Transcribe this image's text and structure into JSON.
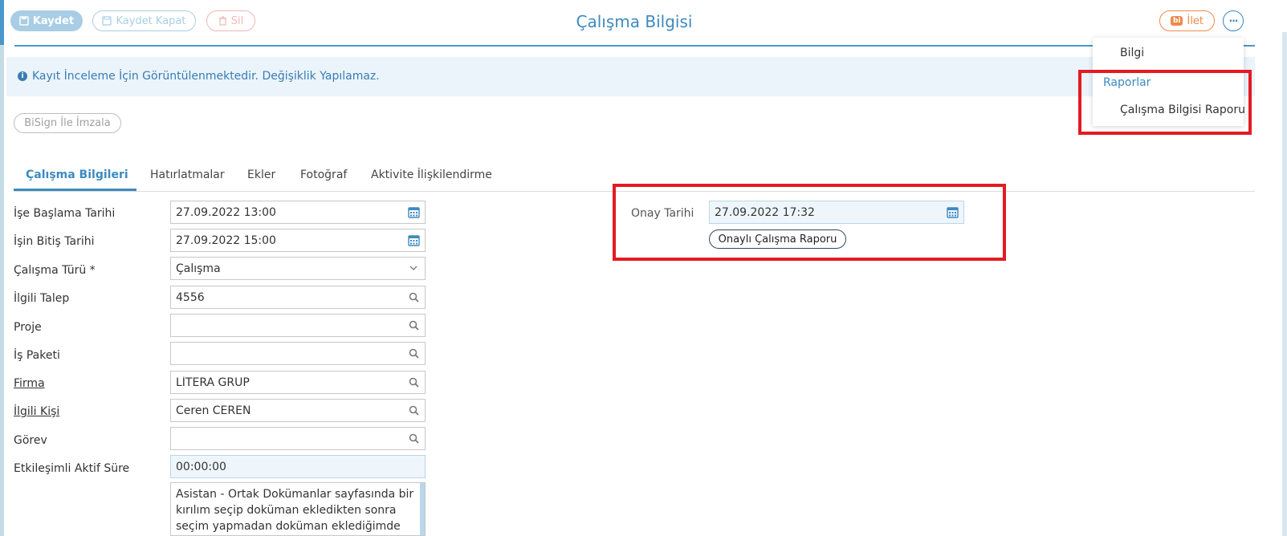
{
  "toolbar": {
    "save_label": "Kaydet",
    "save_close_label": "Kaydet Kapat",
    "delete_label": "Sil",
    "forward_badge": "bi",
    "forward_label": "İlet",
    "more_label": "···"
  },
  "page_title": "Çalışma Bilgisi",
  "info_message": "Kayıt İnceleme İçin Görüntülenmektedir. Değişiklik Yapılamaz.",
  "info_icon": "i",
  "bisign_label": "BiSign İle İmzala",
  "menu": {
    "items": [
      {
        "label": "Bilgi"
      },
      {
        "label": "Raporlar"
      },
      {
        "label": "Çalışma Bilgisi Raporu"
      }
    ]
  },
  "tabs": [
    {
      "label": "Çalışma Bilgileri"
    },
    {
      "label": "Hatırlatmalar"
    },
    {
      "label": "Ekler"
    },
    {
      "label": "Fotoğraf"
    },
    {
      "label": "Aktivite İlişkilendirme"
    }
  ],
  "form": {
    "start_date": {
      "label": "İşe Başlama Tarihi",
      "value": "27.09.2022 13:00"
    },
    "end_date": {
      "label": "İşin Bitiş Tarihi",
      "value": "27.09.2022 15:00"
    },
    "work_type": {
      "label": "Çalışma Türü *",
      "value": "Çalışma"
    },
    "related_request": {
      "label": "İlgili Talep",
      "value": "4556"
    },
    "project": {
      "label": "Proje",
      "value": ""
    },
    "work_package": {
      "label": "İş Paketi",
      "value": ""
    },
    "company": {
      "label": "Firma",
      "value": "LİTERA GRUP"
    },
    "contact": {
      "label": "İlgili Kişi",
      "value": "Ceren CEREN"
    },
    "task": {
      "label": "Görev",
      "value": ""
    },
    "interaction_time": {
      "label": "Etkileşimli Aktif Süre",
      "value": "00:00:00"
    },
    "description": "Asistan - Ortak Dokümanlar sayfasında bir kırılım seçip doküman ekledikten sonra seçim yapmadan doküman eklediğimde"
  },
  "approval": {
    "label": "Onay Tarihi",
    "value": "27.09.2022 17:32",
    "report_button": "Onaylı Çalışma Raporu"
  },
  "colors": {
    "accent": "#3d8ac0",
    "highlight": "#e31b23",
    "forward": "#f08a4b"
  }
}
